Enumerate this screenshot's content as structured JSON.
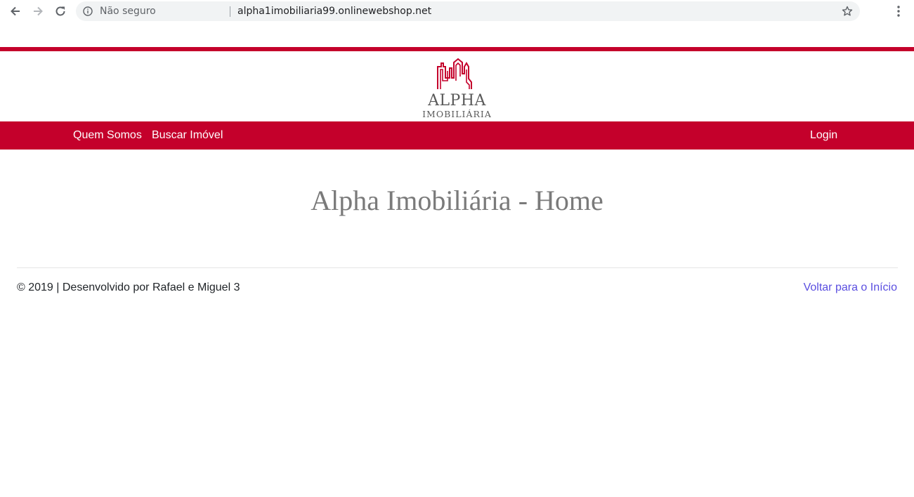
{
  "browser": {
    "not_secure_label": "Não seguro",
    "url": "alpha1imobiliaria99.onlinewebshop.net",
    "icons": [
      "back-arrow-icon",
      "forward-arrow-icon",
      "reload-icon",
      "info-icon",
      "star-icon",
      "menu-dots-icon"
    ]
  },
  "brand": {
    "logo_word": "ALPHA",
    "logo_subword": "IMOBILIÁRIA",
    "color": "#c4002b"
  },
  "nav": {
    "items": [
      {
        "label": "Quem Somos"
      },
      {
        "label": "Buscar Imóvel"
      }
    ],
    "login_label": "Login"
  },
  "main": {
    "heading": "Alpha Imobiliária - Home"
  },
  "footer": {
    "copyright": "© 2019 | Desenvolvido por Rafael e Miguel 3",
    "back_link": "Voltar para o Início",
    "link_color": "#5a4ee0"
  }
}
